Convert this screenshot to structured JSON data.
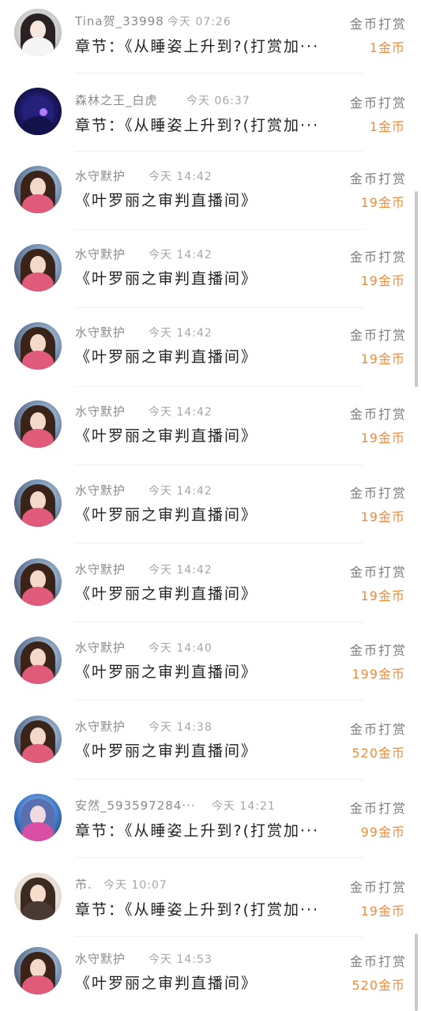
{
  "rewards": [
    {
      "avatar": "female-portrait-icon",
      "username": "Tina贺_33998",
      "time": "今天  07:26",
      "content": "章节：《从睡姿上升到?(打赏加···",
      "reward_type": "金币打赏",
      "amount": "1金币"
    },
    {
      "avatar": "blue-tiger-icon",
      "username": "森林之王_白虎",
      "time": "今天  06:37",
      "content": "章节：《从睡姿上升到?(打赏加···",
      "reward_type": "金币打赏",
      "amount": "1金币"
    },
    {
      "avatar": "fantasy-girl-icon",
      "username": "水守默护",
      "time": "今天  14:42",
      "content": "《叶罗丽之审判直播间》",
      "reward_type": "金币打赏",
      "amount": "19金币"
    },
    {
      "avatar": "fantasy-girl-icon",
      "username": "水守默护",
      "time": "今天  14:42",
      "content": "《叶罗丽之审判直播间》",
      "reward_type": "金币打赏",
      "amount": "19金币"
    },
    {
      "avatar": "fantasy-girl-icon",
      "username": "水守默护",
      "time": "今天  14:42",
      "content": "《叶罗丽之审判直播间》",
      "reward_type": "金币打赏",
      "amount": "19金币"
    },
    {
      "avatar": "fantasy-girl-icon",
      "username": "水守默护",
      "time": "今天  14:42",
      "content": "《叶罗丽之审判直播间》",
      "reward_type": "金币打赏",
      "amount": "19金币"
    },
    {
      "avatar": "fantasy-girl-icon",
      "username": "水守默护",
      "time": "今天  14:42",
      "content": "《叶罗丽之审判直播间》",
      "reward_type": "金币打赏",
      "amount": "19金币"
    },
    {
      "avatar": "fantasy-girl-icon",
      "username": "水守默护",
      "time": "今天  14:42",
      "content": "《叶罗丽之审判直播间》",
      "reward_type": "金币打赏",
      "amount": "19金币"
    },
    {
      "avatar": "fantasy-girl-icon",
      "username": "水守默护",
      "time": "今天  14:40",
      "content": "《叶罗丽之审判直播间》",
      "reward_type": "金币打赏",
      "amount": "199金币"
    },
    {
      "avatar": "fantasy-girl-icon",
      "username": "水守默护",
      "time": "今天  14:38",
      "content": "《叶罗丽之审判直播间》",
      "reward_type": "金币打赏",
      "amount": "520金币"
    },
    {
      "avatar": "anime-couple-icon",
      "username": "安然_593597284···",
      "time": "今天  14:21",
      "content": "章节：《从睡姿上升到?(打赏加···",
      "reward_type": "金币打赏",
      "amount": "99金币"
    },
    {
      "avatar": "woman-portrait-icon",
      "username": "芇.",
      "time": "今天  10:07",
      "content": "章节：《从睡姿上升到?(打赏加···",
      "reward_type": "金币打赏",
      "amount": "19金币"
    },
    {
      "avatar": "fantasy-girl-icon",
      "username": "水守默护",
      "time": "今天  14:53",
      "content": "《叶罗丽之审判直播间》",
      "reward_type": "金币打赏",
      "amount": "520金币"
    }
  ]
}
